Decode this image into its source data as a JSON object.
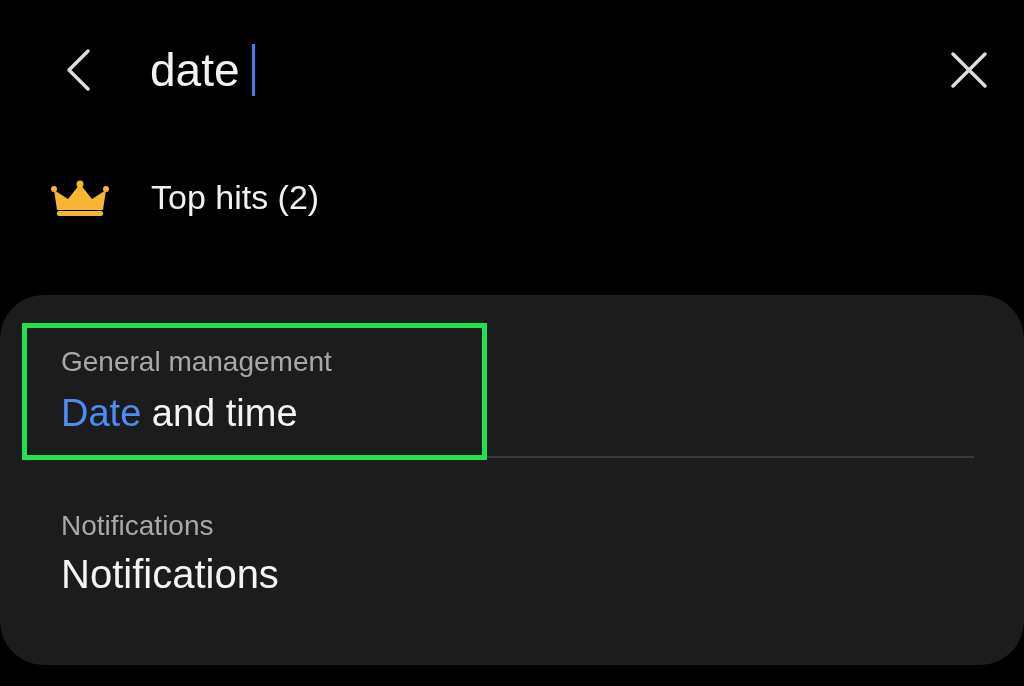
{
  "search": {
    "value": "date"
  },
  "section": {
    "title": "Top hits (2)"
  },
  "results": [
    {
      "category": "General management",
      "match": "Date",
      "rest": " and time",
      "highlighted": true
    },
    {
      "category": "Notifications",
      "rest": "Notifications",
      "highlighted": false
    }
  ]
}
